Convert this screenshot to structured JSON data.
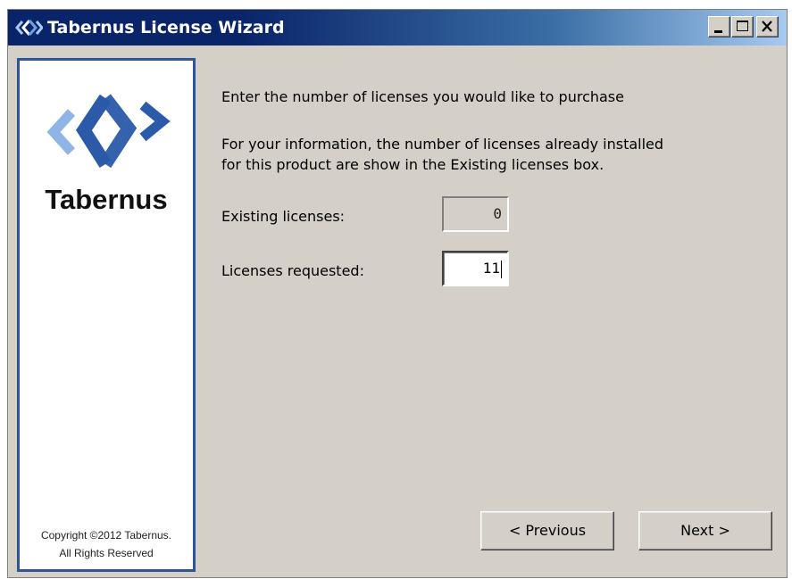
{
  "window": {
    "title": "Tabernus License Wizard",
    "icon": "tabernus-logo-icon",
    "controls": [
      "minimize-icon",
      "maximize-icon",
      "close-icon"
    ]
  },
  "sidebar": {
    "brand": "Tabernus",
    "copyright_line1": "Copyright ©2012 Tabernus.",
    "copyright_line2": "All Rights Reserved"
  },
  "content": {
    "instruction": "Enter the number of licenses you would like to purchase",
    "info_line1": "For your information, the number of licenses already installed",
    "info_line2": "for this product are show in the Existing licenses box.",
    "existing_label": "Existing licenses:",
    "existing_value": "0",
    "requested_label": "Licenses requested:",
    "requested_value": "11"
  },
  "buttons": {
    "previous": "< Previous",
    "next": "Next >"
  },
  "colors": {
    "titlebar_start": "#0a246a",
    "titlebar_end": "#a6caf0",
    "sidebar_border": "#2f5596",
    "logo_blue": "#2a5aa8",
    "dialog_bg": "#d4d0c8"
  }
}
